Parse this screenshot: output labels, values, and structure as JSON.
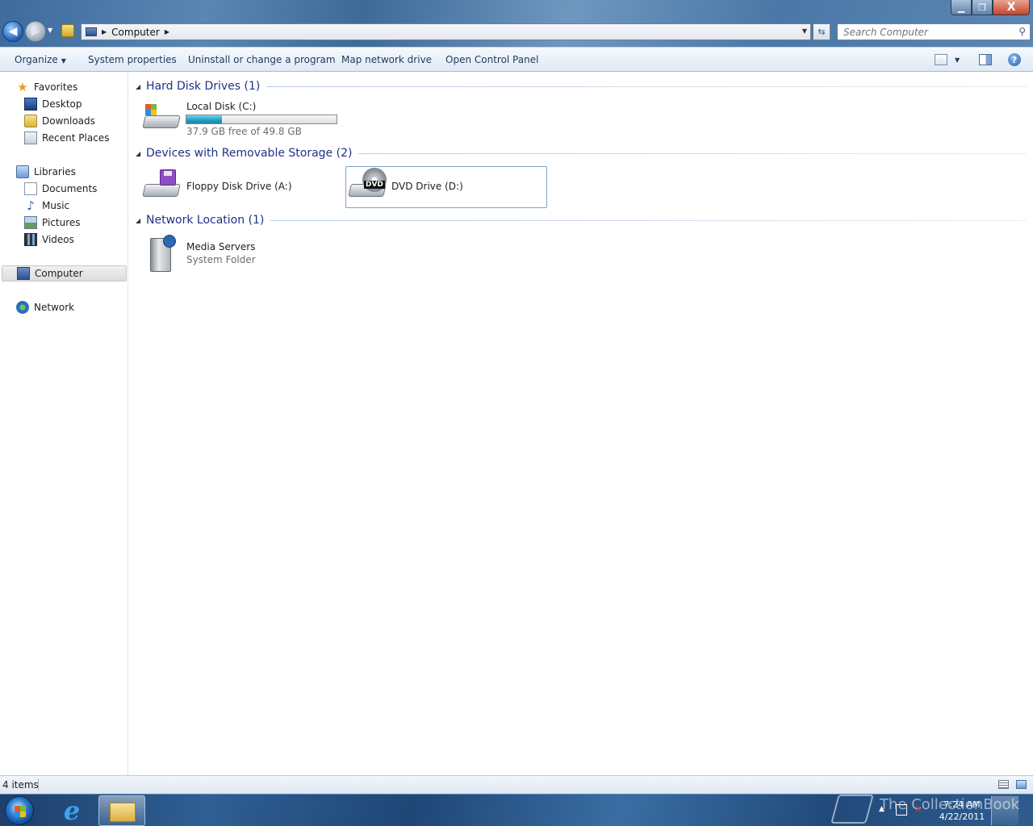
{
  "address": {
    "crumb": "Computer"
  },
  "search": {
    "placeholder": "Search Computer"
  },
  "window_controls": {
    "minimize": "▁",
    "maximize": "❐",
    "close": "X"
  },
  "toolbar": {
    "organize": "Organize",
    "system_properties": "System properties",
    "uninstall": "Uninstall or change a program",
    "map_drive": "Map network drive",
    "control_panel": "Open Control Panel"
  },
  "nav": {
    "favorites": "Favorites",
    "desktop": "Desktop",
    "downloads": "Downloads",
    "recent": "Recent Places",
    "libraries": "Libraries",
    "documents": "Documents",
    "music": "Music",
    "pictures": "Pictures",
    "videos": "Videos",
    "computer": "Computer",
    "network": "Network"
  },
  "groups": {
    "hdd": "Hard Disk Drives (1)",
    "removable": "Devices with Removable Storage (2)",
    "network": "Network Location (1)"
  },
  "items": {
    "local_disk": {
      "name": "Local Disk (C:)",
      "space": "37.9 GB free of 49.8 GB",
      "used_fraction": 0.239
    },
    "floppy": {
      "name": "Floppy Disk Drive (A:)"
    },
    "dvd": {
      "name": "DVD Drive (D:)",
      "badge": "DVD"
    },
    "media": {
      "name": "Media Servers",
      "type": "System Folder"
    }
  },
  "status": {
    "count": "4 items"
  },
  "taskbar": {
    "time": "7:24 AM",
    "date": "4/22/2011",
    "watermark": "The CollectionBook"
  }
}
